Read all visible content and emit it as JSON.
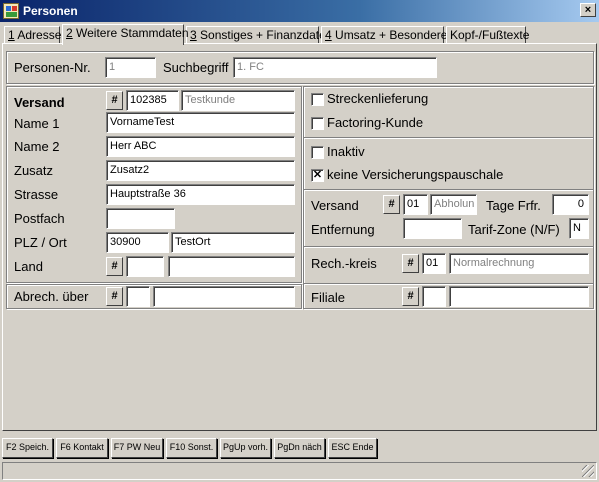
{
  "window": {
    "title": "Personen",
    "close_glyph": "×",
    "icon": "app-icon"
  },
  "tabs": [
    {
      "key": "1",
      "label": " Adresse"
    },
    {
      "key": "2",
      "label": " Weitere Stammdaten"
    },
    {
      "key": "3",
      "label": " Sonstiges + Finanzdaten"
    },
    {
      "key": "4",
      "label": " Umsatz + Besonderes"
    },
    {
      "key": "",
      "label": "Kopf-/Fußtexte"
    }
  ],
  "header": {
    "personen_nr_label": "Personen-Nr.",
    "personen_nr_value": "1",
    "suchbegriff_label": "Suchbegriff",
    "suchbegriff_value": "1. FC"
  },
  "left": {
    "versand_label": "Versand",
    "versand_code": "102385",
    "versand_desc": "Testkunde",
    "name1_label": "Name 1",
    "name1_value": "VornameTest",
    "name2_label": "Name 2",
    "name2_value": "Herr ABC",
    "zusatz_label": "Zusatz",
    "zusatz_value": "Zusatz2",
    "strasse_label": "Strasse",
    "strasse_value": "Hauptstraße 36",
    "postfach_label": "Postfach",
    "postfach_value": "",
    "plz_ort_label": "PLZ / Ort",
    "plz_value": "30900",
    "ort_value": "TestOrt",
    "land_label": "Land",
    "land_code": "",
    "land_desc": "",
    "abrech_label": "Abrech. über",
    "abrech_code": "",
    "abrech_desc": ""
  },
  "right": {
    "streckenlieferung_label": "Streckenlieferung",
    "factoring_label": "Factoring-Kunde",
    "inaktiv_label": "Inaktiv",
    "versicherung_label": "keine Versicherungspauschale",
    "check_mark": "✕",
    "versand_label": "Versand",
    "versand_code": "01",
    "versand_desc": "Abholun",
    "tage_label": "Tage Frfr.",
    "tage_value": "0",
    "entfernung_label": "Entfernung",
    "entfernung_value": "",
    "tarif_label": "Tarif-Zone (N/F)",
    "tarif_value": "N",
    "rechkreis_label": "Rech.-kreis",
    "rechkreis_code": "01",
    "rechkreis_desc": "Normalrechnung",
    "filiale_label": "Filiale",
    "filiale_code": "",
    "filiale_desc": ""
  },
  "states": {
    "streckenlieferung": false,
    "factoring": false,
    "inaktiv": false,
    "versicherung": true
  },
  "hash_glyph": "#",
  "fkeys": [
    "F2 Speich.",
    "F6 Kontakt",
    "F7 PW Neu",
    "F10 Sonst.",
    "PgUp vorh.",
    "PgDn näch",
    "ESC Ende"
  ],
  "statusbar": {
    "text": ""
  }
}
